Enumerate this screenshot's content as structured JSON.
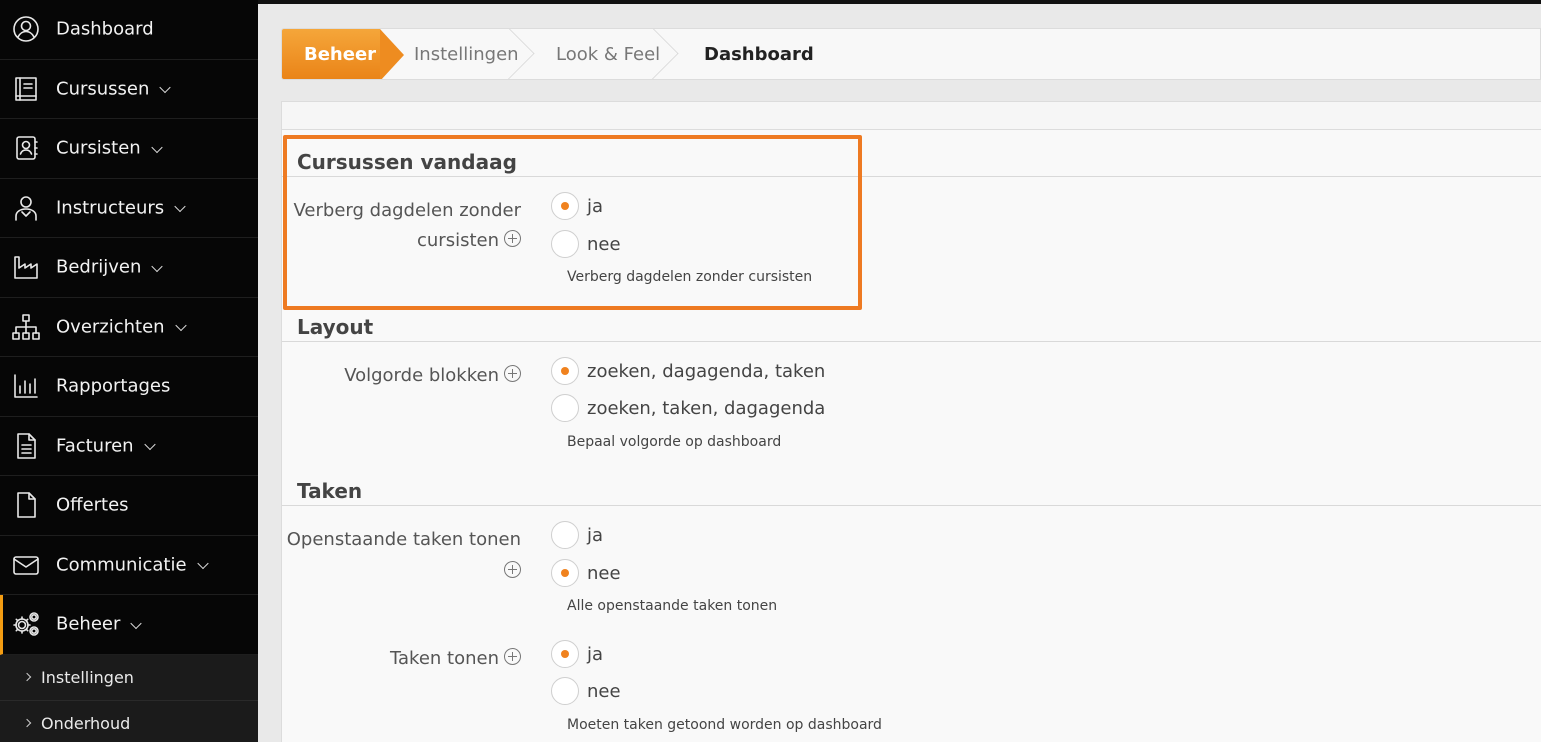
{
  "sidebar": {
    "items": [
      {
        "label": "Dashboard",
        "icon": "user-circle-icon",
        "has_submenu": false
      },
      {
        "label": "Cursussen",
        "icon": "book-icon",
        "has_submenu": true
      },
      {
        "label": "Cursisten",
        "icon": "contact-book-icon",
        "has_submenu": true
      },
      {
        "label": "Instructeurs",
        "icon": "instructor-icon",
        "has_submenu": true
      },
      {
        "label": "Bedrijven",
        "icon": "factory-icon",
        "has_submenu": true
      },
      {
        "label": "Overzichten",
        "icon": "sitemap-icon",
        "has_submenu": true
      },
      {
        "label": "Rapportages",
        "icon": "bar-chart-icon",
        "has_submenu": false
      },
      {
        "label": "Facturen",
        "icon": "document-lines-icon",
        "has_submenu": true
      },
      {
        "label": "Offertes",
        "icon": "document-icon",
        "has_submenu": false
      },
      {
        "label": "Communicatie",
        "icon": "envelope-icon",
        "has_submenu": true
      },
      {
        "label": "Beheer",
        "icon": "gears-icon",
        "has_submenu": true,
        "active": true
      }
    ],
    "subitems": [
      {
        "label": "Instellingen"
      },
      {
        "label": "Onderhoud"
      }
    ]
  },
  "breadcrumb": {
    "home": "Beheer",
    "items": [
      "Instellingen",
      "Look & Feel",
      "Dashboard"
    ]
  },
  "sections": {
    "cursussen": {
      "title": "Cursussen vandaag",
      "field_label_line1": "Verberg dagdelen zonder",
      "field_label_line2": "cursisten",
      "options": [
        "ja",
        "nee"
      ],
      "selected": "ja",
      "help": "Verberg dagdelen zonder cursisten"
    },
    "layout": {
      "title": "Layout",
      "field_label": "Volgorde blokken",
      "options": [
        "zoeken, dagagenda, taken",
        "zoeken, taken, dagagenda"
      ],
      "selected": "zoeken, dagagenda, taken",
      "help": "Bepaal volgorde op dashboard"
    },
    "taken": {
      "title": "Taken",
      "field1": {
        "label": "Openstaande taken tonen",
        "options": [
          "ja",
          "nee"
        ],
        "selected": "nee",
        "help": "Alle openstaande taken tonen"
      },
      "field2": {
        "label": "Taken tonen",
        "options": [
          "ja",
          "nee"
        ],
        "selected": "ja",
        "help": "Moeten taken getoond worden op dashboard"
      }
    }
  },
  "colors": {
    "accent": "#f0821e",
    "highlight_border": "#ee7a22",
    "sidebar_bg": "#060606"
  }
}
